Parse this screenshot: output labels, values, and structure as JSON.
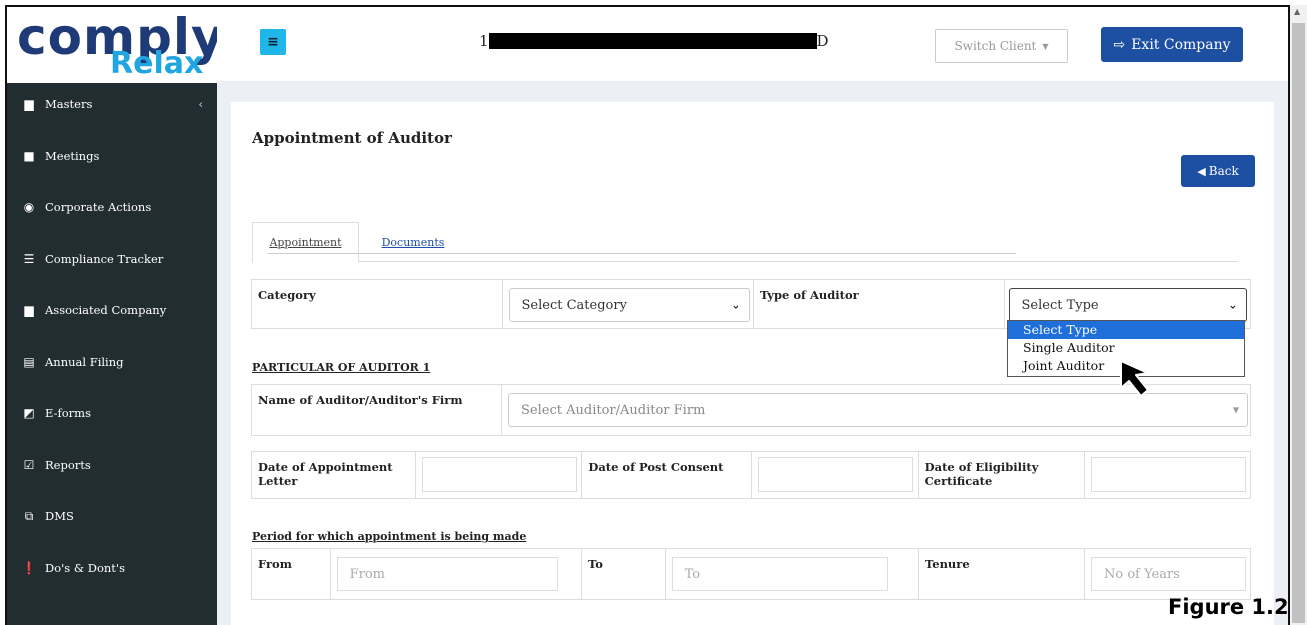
{
  "logo": {
    "word": "comply",
    "sub": "Relax"
  },
  "header": {
    "menu_icon": "≡",
    "client_name_start": "1",
    "client_name_end": "D",
    "switch_client": "Switch Client",
    "exit_company": "Exit Company"
  },
  "sidebar": {
    "items": [
      {
        "label": "Masters",
        "icon": "building-icon"
      },
      {
        "label": "Meetings",
        "icon": "briefcase-icon"
      },
      {
        "label": "Corporate Actions",
        "icon": "target-icon"
      },
      {
        "label": "Compliance Tracker",
        "icon": "list-icon"
      },
      {
        "label": "Associated Company",
        "icon": "building-icon"
      },
      {
        "label": "Annual Filing",
        "icon": "file-icon"
      },
      {
        "label": "E-forms",
        "icon": "edit-icon"
      },
      {
        "label": "Reports",
        "icon": "checkbox-icon"
      },
      {
        "label": "DMS",
        "icon": "copy-icon"
      },
      {
        "label": "Do's & Dont's",
        "icon": "exclamation-icon"
      }
    ]
  },
  "page": {
    "title": "Appointment of Auditor",
    "back": "Back",
    "tabs": [
      "Appointment",
      "Documents"
    ]
  },
  "form": {
    "category_label": "Category",
    "category_value": "Select Category",
    "type_label": "Type of Auditor",
    "type_value": "Select Type",
    "type_options": [
      "Select Type",
      "Single Auditor",
      "Joint Auditor"
    ],
    "particular_heading": "PARTICULAR OF AUDITOR 1",
    "auditor_name_label": "Name of Auditor/Auditor's Firm",
    "auditor_name_placeholder": "Select Auditor/Auditor Firm",
    "date_appointment_label": "Date of Appointment Letter",
    "date_consent_label": "Date of Post Consent",
    "date_eligibility_label": "Date of Eligibility Certificate",
    "period_heading": "Period for which appointment is being made",
    "from_label": "From",
    "from_placeholder": "From",
    "to_label": "To",
    "to_placeholder": "To",
    "tenure_label": "Tenure",
    "tenure_placeholder": "No of Years"
  },
  "figure_label": "Figure 1.2"
}
